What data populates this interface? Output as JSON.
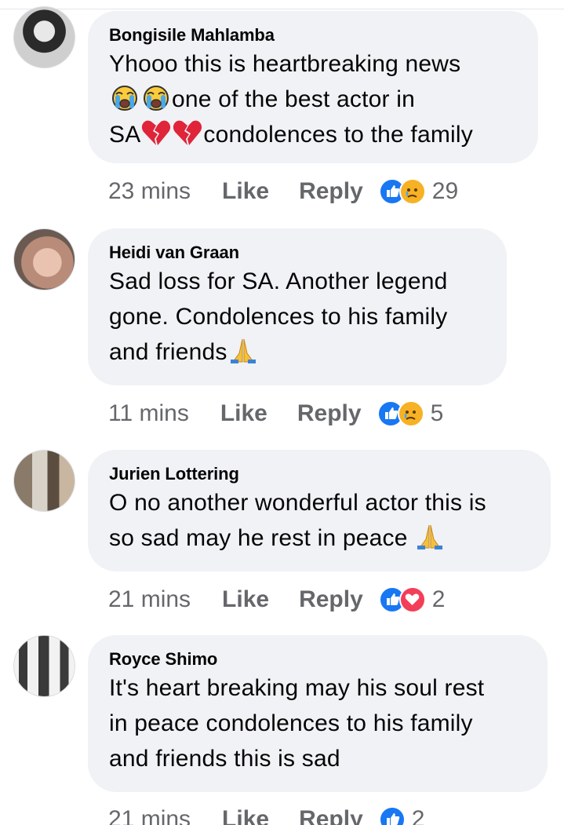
{
  "comments": [
    {
      "author": "Bongisile Mahlamba",
      "lines": [
        "Yhooo this is heartbreaking news",
        "one of the best actor in",
        "SA",
        "condolences to the family"
      ],
      "time": "23 mins",
      "like": "Like",
      "reply": "Reply",
      "reactions": [
        "like",
        "sad"
      ],
      "reaction_count": "29"
    },
    {
      "author": "Heidi van Graan",
      "lines": [
        "Sad loss for SA. Another legend",
        "gone. Condolences to his family",
        "and friends"
      ],
      "time": "11 mins",
      "like": "Like",
      "reply": "Reply",
      "reactions": [
        "like",
        "sad"
      ],
      "reaction_count": "5"
    },
    {
      "author": "Jurien Lottering",
      "lines": [
        "O no another wonderful actor this is",
        "so sad may he rest in peace "
      ],
      "time": "21 mins",
      "like": "Like",
      "reply": "Reply",
      "reactions": [
        "like",
        "love"
      ],
      "reaction_count": "2"
    },
    {
      "author": "Royce Shimo",
      "lines": [
        "It's heart breaking may his soul rest",
        "in peace condolences to his family",
        "and friends this is sad"
      ],
      "time": "21 mins",
      "like": "Like",
      "reply": "Reply",
      "reactions": [
        "like"
      ],
      "reaction_count": "2"
    }
  ],
  "colors": {
    "bubble": "#f0f2f5",
    "meta": "#65676b",
    "like_blue": "#1877f2",
    "love_red": "#f33e58",
    "sad_yellow": "#f7b125"
  },
  "icons": [
    "crying-face-icon",
    "broken-heart-icon",
    "folded-hands-icon",
    "like-reaction-icon",
    "sad-reaction-icon",
    "love-reaction-icon"
  ]
}
